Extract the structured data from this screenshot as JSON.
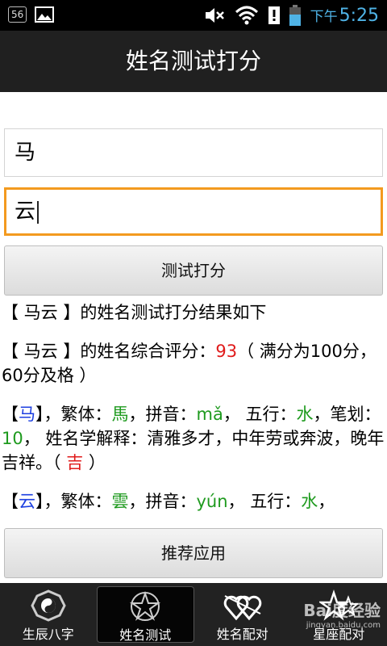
{
  "status_bar": {
    "badge": "56",
    "time_prefix": "下午",
    "time": "5:25",
    "accent_color": "#4fb3e6"
  },
  "title": "姓名测试打分",
  "form": {
    "surname_value": "马",
    "given_name_value": "云",
    "submit_label": "测试打分"
  },
  "result": {
    "heading": "【 马云 】的姓名测试打分结果如下",
    "score_prefix": "【 马云 】的姓名综合评分：",
    "score": "93",
    "score_suffix": "（ 满分为100分，60分及格 ）",
    "char1": {
      "open": "【",
      "char": "马",
      "close": "】，繁体：",
      "traditional": "馬",
      "pinyin_label": "，拼音：",
      "pinyin": "mǎ",
      "wuxing_label": "， 五行：",
      "wuxing": "水",
      "strokes_label": "，笔划：",
      "strokes": "10",
      "meaning_label": "， 姓名学解释：清雅多才，中年劳或奔波，晚年吉祥。（ ",
      "luck": "吉",
      "end": " ）"
    },
    "char2": {
      "open": "【",
      "char": "云",
      "close": "】，繁体：",
      "traditional": "雲",
      "pinyin_label": "，拼音：",
      "pinyin": "yún",
      "wuxing_label": "， 五行：",
      "wuxing": "水",
      "rest": "，"
    }
  },
  "recommend_label": "推荐应用",
  "bottom_nav": [
    {
      "label": "生辰八字",
      "icon": "bagua-icon"
    },
    {
      "label": "姓名测试",
      "icon": "pentagram-icon",
      "active": true
    },
    {
      "label": "姓名配对",
      "icon": "hearts-icon"
    },
    {
      "label": "星座配对",
      "icon": "stars-icon"
    }
  ],
  "watermark": {
    "text": "Bai度经验",
    "sub": "jingyan.baidu.com"
  }
}
